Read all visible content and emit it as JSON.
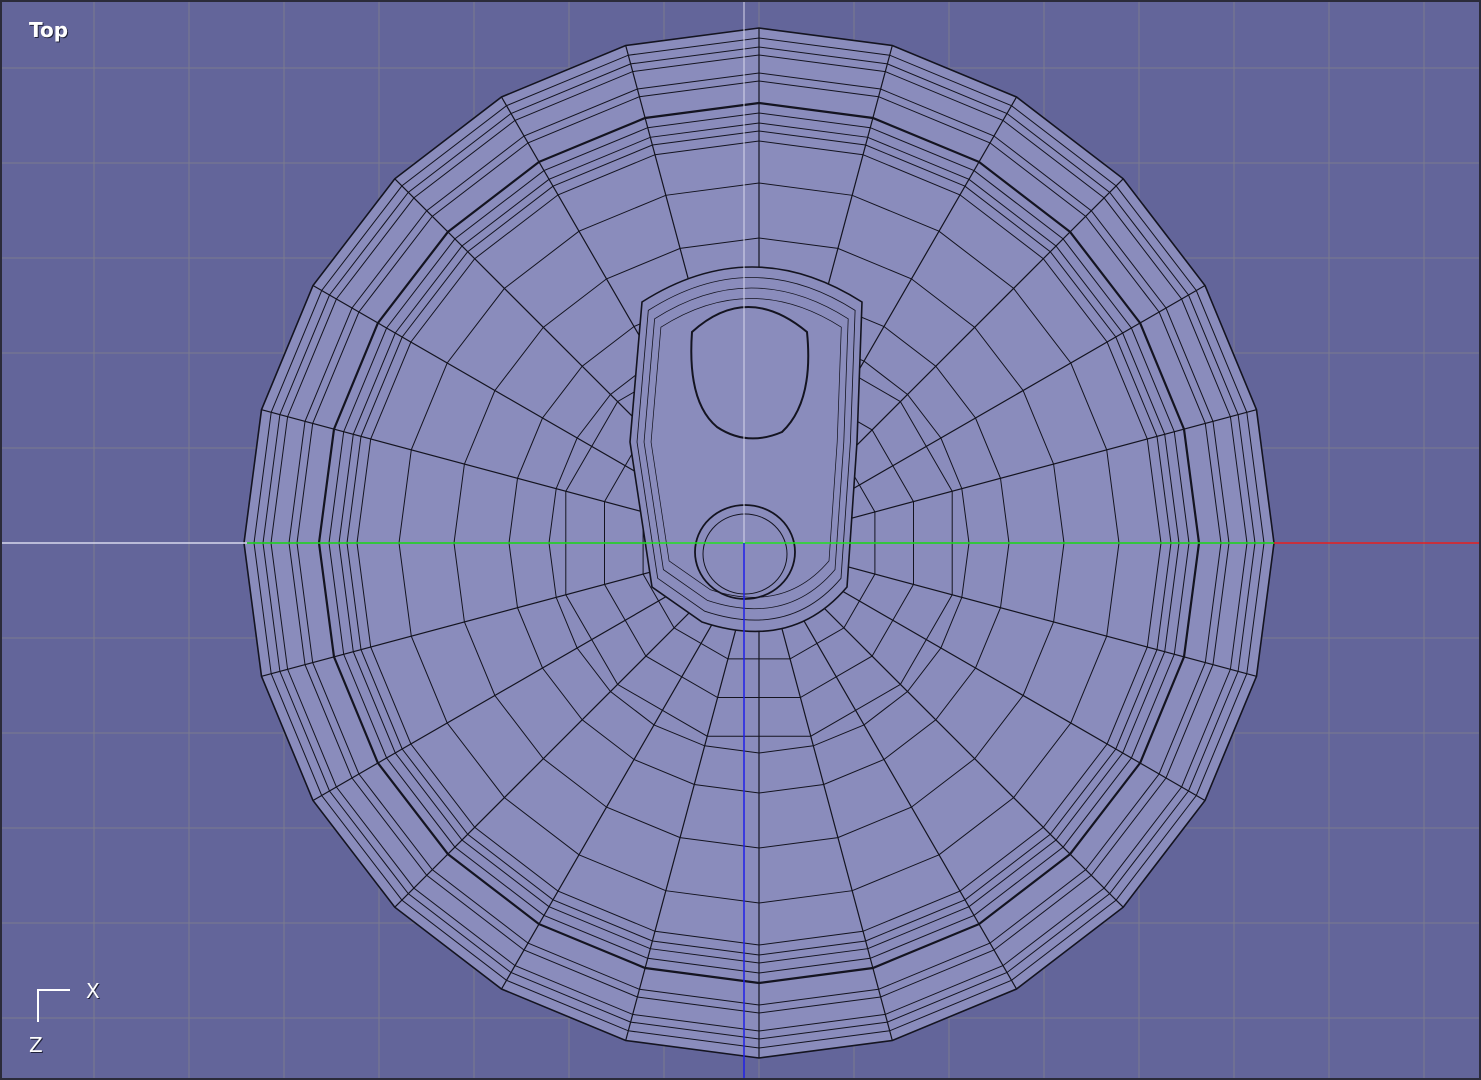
{
  "viewport": {
    "label": "Top",
    "axis_labels": {
      "horizontal": "X",
      "vertical": "Z"
    },
    "colors": {
      "background": "#63659a",
      "grid": "#7b7c8e",
      "mesh_fill": "#8a8cbc",
      "wire": "#141420",
      "axis_x": "#e82020",
      "axis_x_negative": "#d8d8ec",
      "axis_y": "#22e022",
      "axis_z": "#2020e8",
      "axis_z_negative": "#d8d8ec"
    }
  }
}
